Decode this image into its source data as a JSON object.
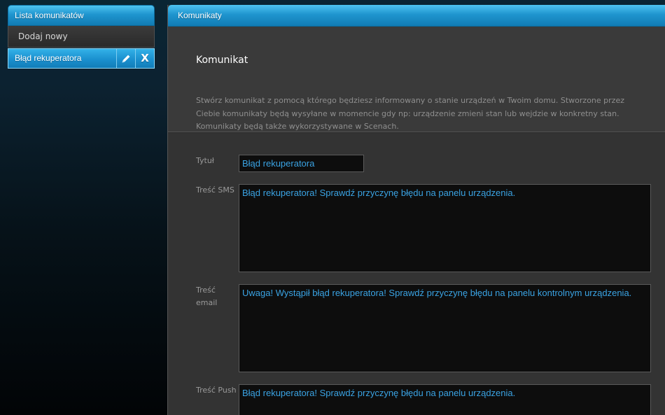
{
  "sidebar": {
    "header": "Lista komunikatów",
    "add_new": "Dodaj nowy",
    "items": [
      {
        "label": "Błąd rekuperatora",
        "delete_glyph": "X"
      }
    ]
  },
  "main": {
    "header": "Komunikaty",
    "section_title": "Komunikat",
    "description_lines": [
      "Stwórz komunikat z pomocą którego będziesz informowany o stanie urządzeń w Twoim domu. Stworzone przez",
      "Ciebie komunikaty będą wysyłane w momencie gdy np: urządzenie zmieni stan lub wejdzie w konkretny stan.",
      "Komunikaty będą także wykorzystywane w Scenach."
    ]
  },
  "form": {
    "title_label": "Tytuł",
    "title_value": "Błąd rekuperatora",
    "sms_label": "Treść SMS",
    "sms_value": "Błąd rekuperatora! Sprawdź przyczynę błędu na panelu urządzenia.",
    "email_label_line1": "Treść",
    "email_label_line2": "email",
    "email_value": "Uwaga! Wystąpił błąd rekuperatora! Sprawdź przyczynę błędu na panelu kontrolnym urządzenia.",
    "push_label": "Treść Push",
    "push_value": "Błąd rekuperatora! Sprawdź przyczynę błędu na panelu urządzenia."
  },
  "colors": {
    "accent": "#1f95cf",
    "input_text": "#3aa3e3"
  }
}
